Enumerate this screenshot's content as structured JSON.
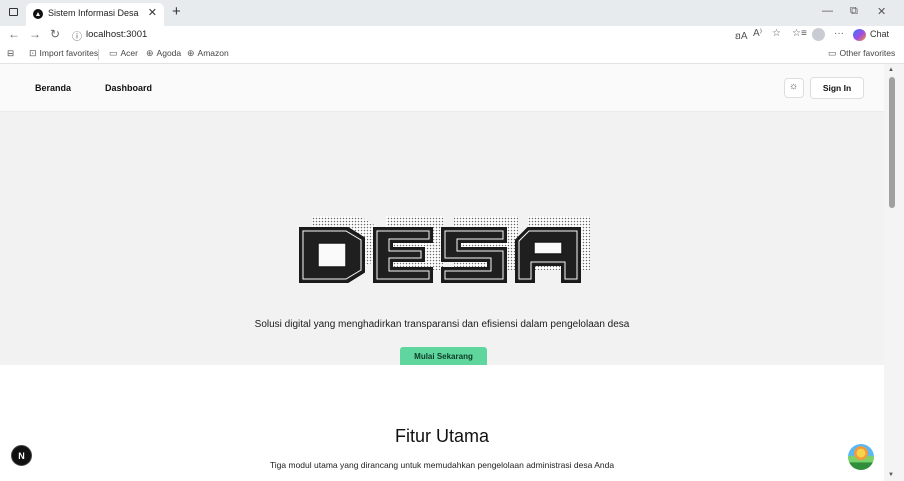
{
  "browser": {
    "tab_title": "Sistem Informasi Desa",
    "url": "localhost:3001",
    "chat_label": "Chat",
    "bookmarks": [
      "Import favorites",
      "Acer",
      "Agoda",
      "Amazon"
    ],
    "other_favorites": "Other favorites"
  },
  "site_nav": {
    "links": [
      "Beranda",
      "Dashboard"
    ],
    "sign_in": "Sign In"
  },
  "hero": {
    "logo_text": "DESA",
    "tagline": "Solusi digital yang menghadirkan transparansi dan efisiensi dalam pengelolaan desa",
    "cta": "Mulai Sekarang",
    "cta_color": "#5fd69e"
  },
  "features": {
    "title": "Fitur Utama",
    "subtitle": "Tiga modul utama yang dirancang untuk memudahkan pengelolaan administrasi desa Anda"
  },
  "badges": {
    "dev_badge": "N"
  },
  "icons": [
    "window-icon",
    "tab-favicon",
    "close-icon",
    "plus-icon",
    "back-icon",
    "forward-icon",
    "refresh-icon",
    "info-icon",
    "read-aloud-icon",
    "star-icon",
    "favorites-icon",
    "profile-icon",
    "more-icon",
    "copilot-icon",
    "folder-icon",
    "globe-icon",
    "sun-icon"
  ]
}
